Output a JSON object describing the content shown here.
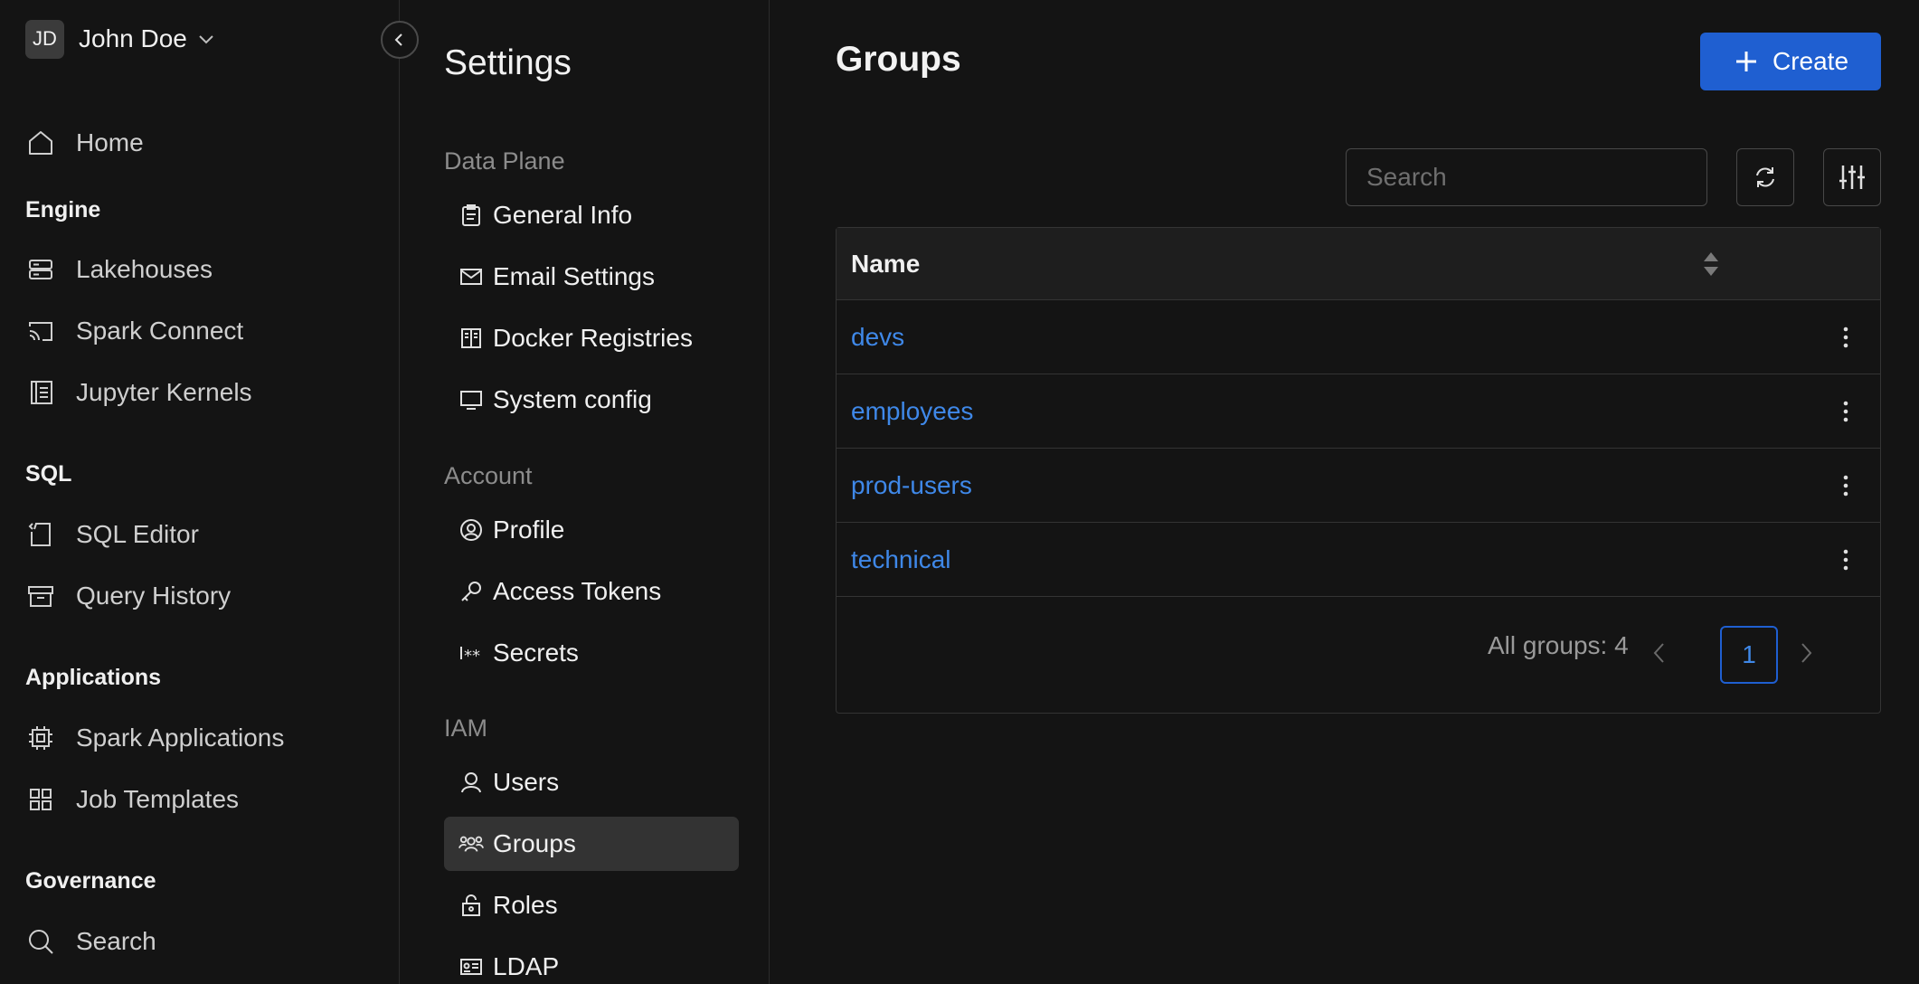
{
  "user": {
    "initials": "JD",
    "name": "John Doe"
  },
  "sidebar": {
    "home": "Home",
    "sections": [
      {
        "title": "Engine",
        "items": [
          "Lakehouses",
          "Spark Connect",
          "Jupyter Kernels"
        ]
      },
      {
        "title": "SQL",
        "items": [
          "SQL Editor",
          "Query History"
        ]
      },
      {
        "title": "Applications",
        "items": [
          "Spark Applications",
          "Job Templates"
        ]
      },
      {
        "title": "Governance",
        "items": [
          "Search"
        ]
      }
    ]
  },
  "settings": {
    "title": "Settings",
    "groups": [
      {
        "label": "Data Plane",
        "items": [
          "General Info",
          "Email Settings",
          "Docker Registries",
          "System config"
        ]
      },
      {
        "label": "Account",
        "items": [
          "Profile",
          "Access Tokens",
          "Secrets"
        ]
      },
      {
        "label": "IAM",
        "items": [
          "Users",
          "Groups",
          "Roles",
          "LDAP"
        ]
      }
    ],
    "active": "Groups"
  },
  "main": {
    "title": "Groups",
    "create_label": "Create",
    "search_placeholder": "Search",
    "table": {
      "column": "Name",
      "rows": [
        "devs",
        "employees",
        "prod-users",
        "technical"
      ]
    },
    "pagination": {
      "total_text": "All groups: 4",
      "current_page": "1"
    }
  },
  "colors": {
    "accent": "#1f5fd1",
    "link": "#3f88e8",
    "background": "#141414"
  }
}
